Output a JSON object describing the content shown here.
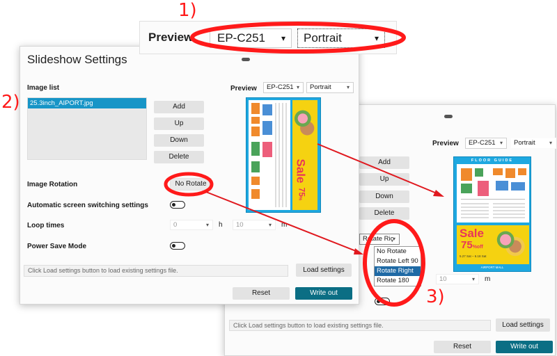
{
  "callouts": [
    "1)",
    "2)",
    "3)"
  ],
  "zoom": {
    "preview_label": "Preview",
    "device": "EP-C251",
    "orientation": "Portrait"
  },
  "main": {
    "title": "Slideshow Settings",
    "image_list_label": "Image list",
    "selected_file": "25.3inch_AIPORT.jpg",
    "buttons": {
      "add": "Add",
      "up": "Up",
      "down": "Down",
      "delete": "Delete"
    },
    "preview_label": "Preview",
    "device": "EP-C251",
    "orientation": "Portrait",
    "image_rotation_label": "Image Rotation",
    "rotation_value": "No Rotate",
    "auto_switch_label": "Automatic screen switching settings",
    "loop_times_label": "Loop times",
    "loop_hours": "0",
    "hours_unit": "h",
    "loop_minutes": "10",
    "minutes_unit": "m",
    "power_save_label": "Power Save Mode",
    "settings_hint": "Click Load settings button to load existing settings file.",
    "load_settings": "Load settings",
    "reset": "Reset",
    "write_out": "Write out"
  },
  "second": {
    "preview_label": "Preview",
    "device": "EP-C251",
    "orientation": "Portrait",
    "buttons": {
      "add": "Add",
      "up": "Up",
      "down": "Down",
      "delete": "Delete"
    },
    "rotation_selected": "Rotate Riç",
    "rotation_options": [
      "No Rotate",
      "Rotate Left 90",
      "Rotate Right 90",
      "Rotate 180"
    ],
    "loop_minutes": "10",
    "minutes_unit": "m",
    "settings_hint": "Click Load settings button to load existing settings file.",
    "load_settings": "Load settings",
    "reset": "Reset",
    "write_out": "Write out"
  },
  "poster": {
    "header": "FLOOR GUIDE",
    "sale_word": "Sale",
    "sale_percent": "75",
    "sale_suffix": "off",
    "sale_dates": "5.27 Sat – 6.18 Sat",
    "footer": "AIRPORT MALL"
  },
  "colors": {
    "accent": "#0b6e84",
    "annotation_red": "#ff1a1a",
    "poster_blue": "#1ea8e0",
    "poster_yellow": "#f5d211",
    "poster_pink": "#e8365a",
    "selected_row": "#1f6aa5"
  }
}
